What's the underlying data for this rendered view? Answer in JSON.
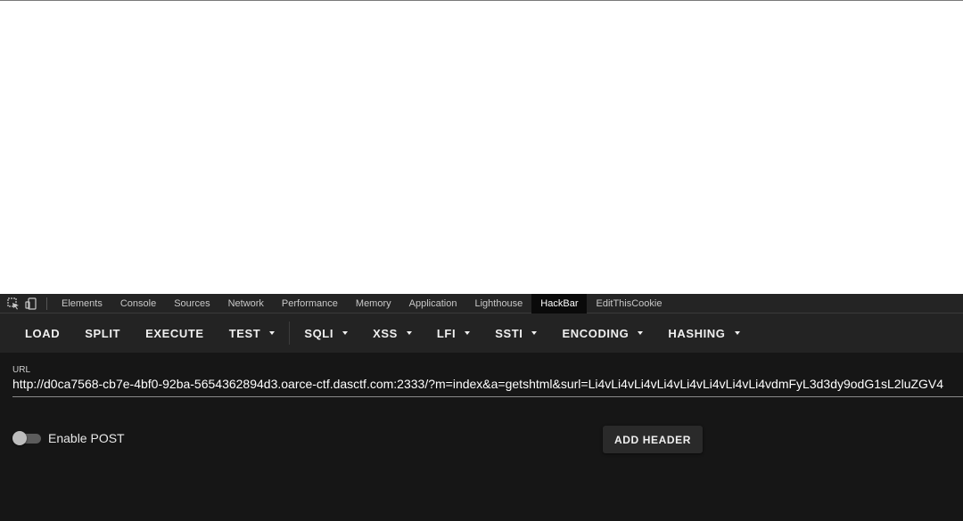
{
  "tabs": [
    {
      "label": "Elements"
    },
    {
      "label": "Console"
    },
    {
      "label": "Sources"
    },
    {
      "label": "Network"
    },
    {
      "label": "Performance"
    },
    {
      "label": "Memory"
    },
    {
      "label": "Application"
    },
    {
      "label": "Lighthouse"
    },
    {
      "label": "HackBar",
      "active": true
    },
    {
      "label": "EditThisCookie"
    }
  ],
  "toolbar": {
    "load": "LOAD",
    "split": "SPLIT",
    "execute": "EXECUTE",
    "test": "TEST",
    "sqli": "SQLI",
    "xss": "XSS",
    "lfi": "LFI",
    "ssti": "SSTI",
    "encoding": "ENCODING",
    "hashing": "HASHING"
  },
  "url": {
    "label": "URL",
    "value": "http://d0ca7568-cb7e-4bf0-92ba-5654362894d3.oarce-ctf.dasctf.com:2333/?m=index&a=getshtml&surl=Li4vLi4vLi4vLi4vLi4vLi4vLi4vLi4vdmFyL3d3dy9odG1sL2luZGV4"
  },
  "post": {
    "label": "Enable POST",
    "enabled": false
  },
  "add_header": {
    "label": "ADD HEADER"
  },
  "colors": {
    "devtools_bg": "#161616",
    "toolbar_bg": "#232323",
    "tabbar_bg": "#242424",
    "active_tab_bg": "#0a0a0a"
  }
}
